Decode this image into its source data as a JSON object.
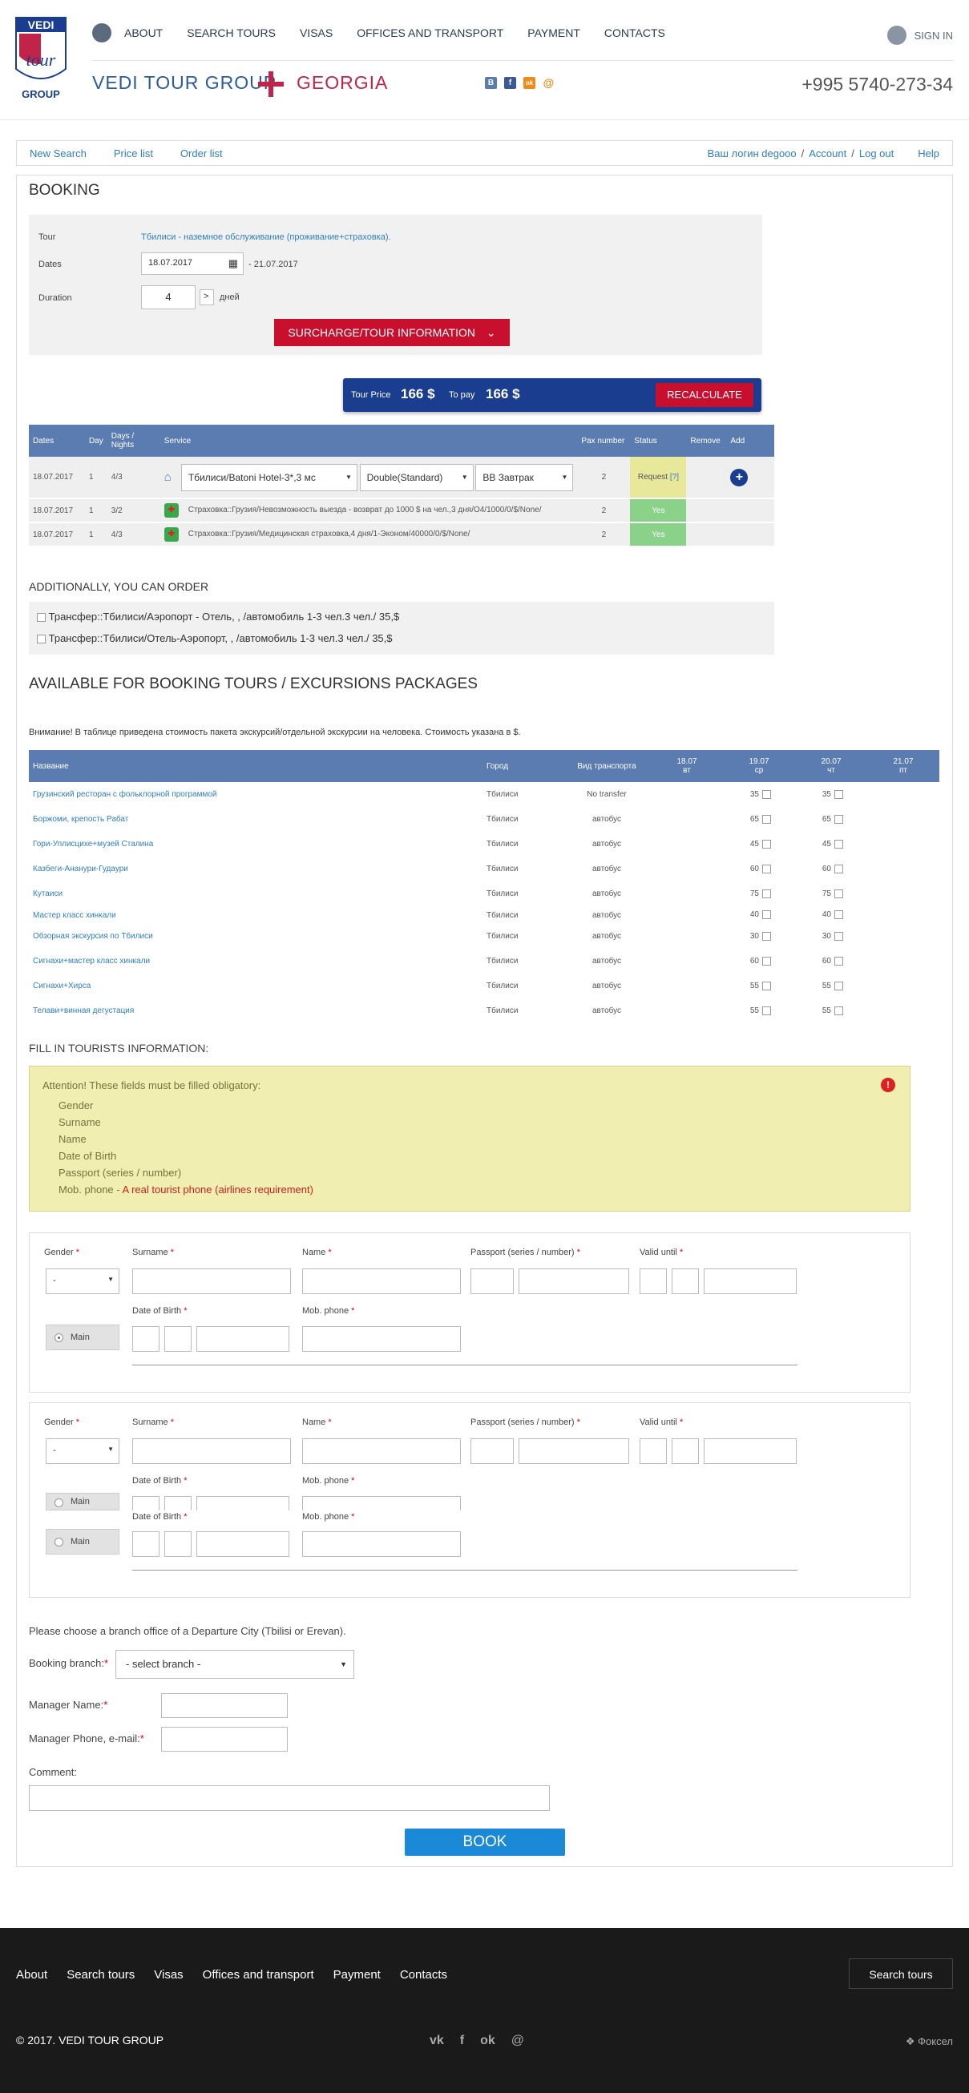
{
  "header": {
    "nav": [
      "ABOUT",
      "SEARCH TOURS",
      "VISAS",
      "OFFICES AND TRANSPORT",
      "PAYMENT",
      "CONTACTS"
    ],
    "signin": "SIGN IN",
    "brand": "VEDI TOUR GROUP",
    "country": "GEORGIA",
    "phone": "+995 5740-273-34",
    "logo_top": "VEDI",
    "logo_mid": "tour",
    "logo_bot": "GROUP",
    "social": [
      "В",
      "f",
      "ok",
      "@"
    ]
  },
  "subnav": {
    "left": [
      "New Search",
      "Price list",
      "Order list"
    ],
    "login": "Ваш логин degooo",
    "sep": "/",
    "account": "Account",
    "logout": "Log out",
    "help": "Help"
  },
  "booking": {
    "title": "BOOKING",
    "tour_label": "Tour",
    "tour_value": "Тбилиси - наземное обслуживание (проживание+страховка).",
    "dates_label": "Dates",
    "date_from": "18.07.2017",
    "date_to": "- 21.07.2017",
    "duration_label": "Duration",
    "duration": "4",
    "duration_btn": ">",
    "duration_unit": "дней",
    "surcharge": "SURCHARGE/TOUR INFORMATION"
  },
  "price": {
    "tour_price_label": "Tour Price",
    "tour_price": "166 $",
    "to_pay_label": "To pay",
    "to_pay": "166 $",
    "recalc": "RECALCULATE"
  },
  "services": {
    "headers": [
      "Dates",
      "Day",
      "Days / Nights",
      "Service",
      "Pax number",
      "Status",
      "Remove",
      "Add"
    ],
    "row1": {
      "date": "18.07.2017",
      "day": "1",
      "dn": "4/3",
      "hotel": "Тбилиси/Batoni Hotel-3*,3 мс",
      "room": "Double(Standard)",
      "meal": "BB Завтрак",
      "pax": "2",
      "status": "Request",
      "help": "[?]"
    },
    "row2": {
      "date": "18.07.2017",
      "day": "1",
      "dn": "3/2",
      "service": "Страховка::Грузия/Невозможность выезда - возврат до 1000 $ на чел.,3 дня/О4/1000/0/$/None/",
      "pax": "2",
      "status": "Yes"
    },
    "row3": {
      "date": "18.07.2017",
      "day": "1",
      "dn": "4/3",
      "service": "Страховка::Грузия/Медицинская страховка,4 дня/1-Эконом/40000/0/$/None/",
      "pax": "2",
      "status": "Yes"
    }
  },
  "additional": {
    "title": "ADDITIONALLY, YOU CAN ORDER",
    "items": [
      "Трансфер::Тбилиси/Аэропорт - Отель, , /автомобиль 1-3 чел.3 чел./ 35,$",
      "Трансфер::Тбилиси/Отель-Аэропорт, , /автомобиль 1-3 чел.3 чел./ 35,$"
    ]
  },
  "excursions": {
    "title": "AVAILABLE FOR BOOKING TOURS / EXCURSIONS PACKAGES",
    "note": "Внимание! В таблице приведена стоимость пакета экскурсий/отдельной экскурсии на человека. Стоимость указана в $.",
    "headers": {
      "name": "Название",
      "city": "Город",
      "transport": "Вид транспорта",
      "d1": "18.07",
      "w1": "вт",
      "d2": "19.07",
      "w2": "ср",
      "d3": "20.07",
      "w3": "чт",
      "d4": "21.07",
      "w4": "пт"
    },
    "rows": [
      {
        "name": "Грузинский ресторан с фольклорной программой",
        "city": "Тбилиси",
        "transport": "No transfer",
        "p19": "35",
        "p20": "35"
      },
      {
        "name": "Боржоми, крепость Рабат",
        "city": "Тбилиси",
        "transport": "автобус",
        "p19": "65",
        "p20": "65"
      },
      {
        "name": "Гори-Уплисцихе+музей Сталина",
        "city": "Тбилиси",
        "transport": "автобус",
        "p19": "45",
        "p20": "45"
      },
      {
        "name": "Казбеги-Ананури-Гудаури",
        "city": "Тбилиси",
        "transport": "автобус",
        "p19": "60",
        "p20": "60"
      },
      {
        "name": "Кутаиси",
        "city": "Тбилиси",
        "transport": "автобус",
        "p19": "75",
        "p20": "75"
      },
      {
        "name": "Мастер класс хинкали",
        "city": "Тбилиси",
        "transport": "автобус",
        "p19": "40",
        "p20": "40"
      },
      {
        "name": "Обзорная экскурсия по Тбилиси",
        "city": "Тбилиси",
        "transport": "автобус",
        "p19": "30",
        "p20": "30"
      },
      {
        "name": "Сигнахи+мастер класс хинкали",
        "city": "Тбилиси",
        "transport": "автобус",
        "p19": "60",
        "p20": "60"
      },
      {
        "name": "Сигнахи+Хирса",
        "city": "Тбилиси",
        "transport": "автобус",
        "p19": "55",
        "p20": "55"
      },
      {
        "name": "Телави+винная дегустация",
        "city": "Тбилиси",
        "transport": "автобус",
        "p19": "55",
        "p20": "55"
      }
    ]
  },
  "tourists": {
    "title": "FILL IN TOURISTS INFORMATION:",
    "attention": "Attention! These fields must be filled obligatory:",
    "fields": [
      "Gender",
      "Surname",
      "Name",
      "Date of Birth",
      "Passport (series / number)"
    ],
    "mob": "Mob. phone - ",
    "mob_red": "A real tourist phone (airlines requirement)",
    "gender": "Gender",
    "surname": "Surname",
    "name": "Name",
    "passport": "Passport (series / number)",
    "valid": "Valid until",
    "dob": "Date of Birth",
    "mobphone": "Mob. phone",
    "main": "Main",
    "gender_val": "-",
    "star": "*"
  },
  "branch": {
    "prompt": "Please choose a branch office of a Departure City (Tbilisi or Erevan).",
    "label": "Booking branch:",
    "star": "*",
    "select": "- select branch -",
    "manager": "Manager Name:",
    "manager_phone": "Manager Phone, e-mail:",
    "comment": "Comment:",
    "book": "BOOK"
  },
  "footer": {
    "links": [
      "About",
      "Search tours",
      "Visas",
      "Offices and transport",
      "Payment",
      "Contacts"
    ],
    "search": "Search tours",
    "copy": "© 2017. VEDI TOUR GROUP",
    "social": [
      "vk",
      "f",
      "ok",
      "@"
    ],
    "fox": "Фоксел"
  }
}
